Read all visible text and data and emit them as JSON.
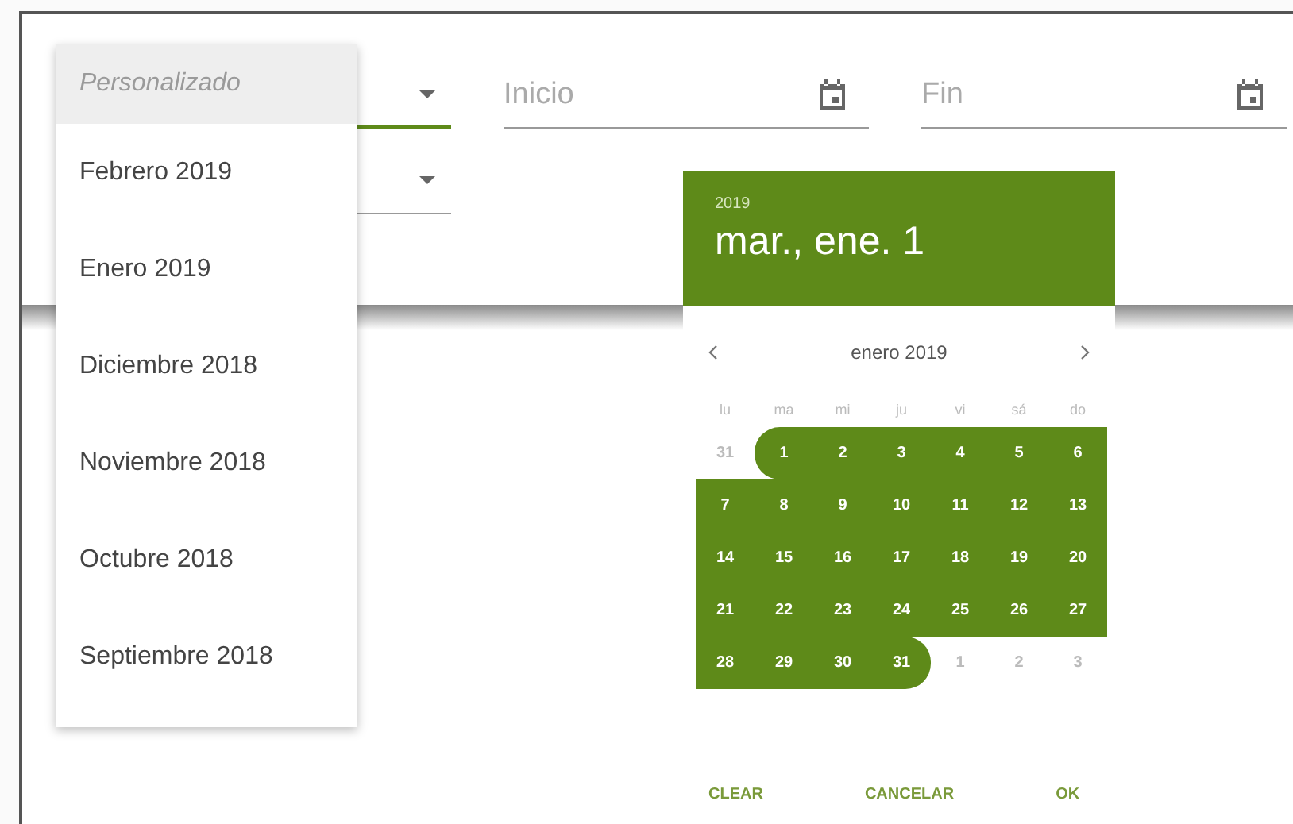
{
  "filter_select": {
    "focused": true
  },
  "period_select": {
    "focused": false
  },
  "start_field": {
    "placeholder": "Inicio"
  },
  "end_field": {
    "placeholder": "Fin"
  },
  "month_menu": {
    "items": [
      {
        "label": "Personalizado",
        "disabled": true
      },
      {
        "label": "Febrero 2019",
        "disabled": false
      },
      {
        "label": "Enero 2019",
        "disabled": false
      },
      {
        "label": "Diciembre 2018",
        "disabled": false
      },
      {
        "label": "Noviembre 2018",
        "disabled": false
      },
      {
        "label": "Octubre 2018",
        "disabled": false
      },
      {
        "label": "Septiembre 2018",
        "disabled": false
      }
    ]
  },
  "date_picker": {
    "year": "2019",
    "date": "mar., ene. 1",
    "month_label": "enero 2019",
    "weekdays": [
      "lu",
      "ma",
      "mi",
      "ju",
      "vi",
      "sá",
      "do"
    ],
    "weeks": [
      [
        {
          "day": "31",
          "outside": true,
          "in_range": false
        },
        {
          "day": "1",
          "outside": false,
          "in_range": true
        },
        {
          "day": "2",
          "outside": false,
          "in_range": true
        },
        {
          "day": "3",
          "outside": false,
          "in_range": true
        },
        {
          "day": "4",
          "outside": false,
          "in_range": true
        },
        {
          "day": "5",
          "outside": false,
          "in_range": true
        },
        {
          "day": "6",
          "outside": false,
          "in_range": true
        }
      ],
      [
        {
          "day": "7",
          "outside": false,
          "in_range": true
        },
        {
          "day": "8",
          "outside": false,
          "in_range": true
        },
        {
          "day": "9",
          "outside": false,
          "in_range": true
        },
        {
          "day": "10",
          "outside": false,
          "in_range": true
        },
        {
          "day": "11",
          "outside": false,
          "in_range": true
        },
        {
          "day": "12",
          "outside": false,
          "in_range": true
        },
        {
          "day": "13",
          "outside": false,
          "in_range": true
        }
      ],
      [
        {
          "day": "14",
          "outside": false,
          "in_range": true
        },
        {
          "day": "15",
          "outside": false,
          "in_range": true
        },
        {
          "day": "16",
          "outside": false,
          "in_range": true
        },
        {
          "day": "17",
          "outside": false,
          "in_range": true
        },
        {
          "day": "18",
          "outside": false,
          "in_range": true
        },
        {
          "day": "19",
          "outside": false,
          "in_range": true
        },
        {
          "day": "20",
          "outside": false,
          "in_range": true
        }
      ],
      [
        {
          "day": "21",
          "outside": false,
          "in_range": true
        },
        {
          "day": "22",
          "outside": false,
          "in_range": true
        },
        {
          "day": "23",
          "outside": false,
          "in_range": true
        },
        {
          "day": "24",
          "outside": false,
          "in_range": true
        },
        {
          "day": "25",
          "outside": false,
          "in_range": true
        },
        {
          "day": "26",
          "outside": false,
          "in_range": true
        },
        {
          "day": "27",
          "outside": false,
          "in_range": true
        }
      ],
      [
        {
          "day": "28",
          "outside": false,
          "in_range": true
        },
        {
          "day": "29",
          "outside": false,
          "in_range": true
        },
        {
          "day": "30",
          "outside": false,
          "in_range": true
        },
        {
          "day": "31",
          "outside": false,
          "in_range": true
        },
        {
          "day": "1",
          "outside": true,
          "in_range": false
        },
        {
          "day": "2",
          "outside": true,
          "in_range": false
        },
        {
          "day": "3",
          "outside": true,
          "in_range": false
        }
      ]
    ],
    "actions": [
      "CLEAR",
      "CANCELAR",
      "OK"
    ]
  }
}
